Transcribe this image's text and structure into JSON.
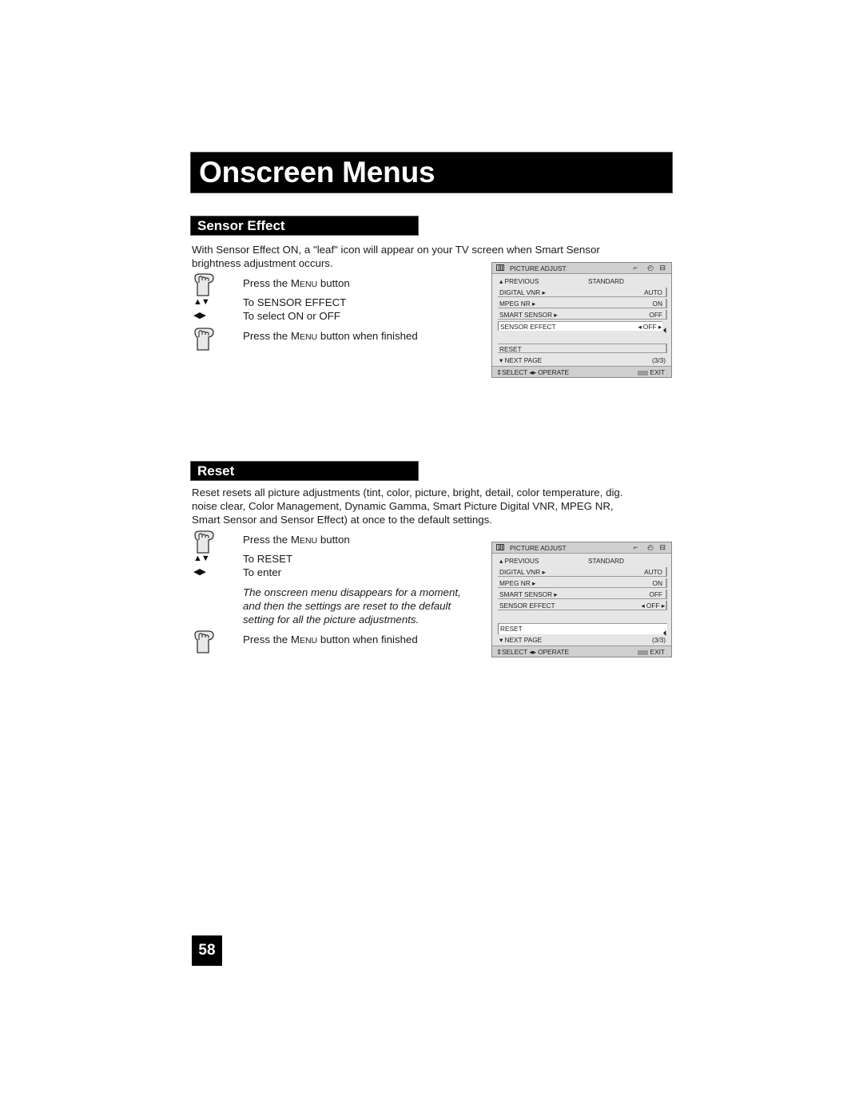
{
  "page_title": "Onscreen Menus",
  "page_number": "58",
  "sections": [
    {
      "heading": "Sensor Effect",
      "intro_line1": "With Sensor Effect ON, a \"leaf\" icon will appear on your TV screen when Smart Sensor",
      "intro_line2": "brightness adjustment occurs.",
      "steps": [
        {
          "icon": "hand-press-icon",
          "pre": "Press the M",
          "sc": "ENU",
          "post": " button"
        },
        {
          "icon": "up-down-arrows-icon",
          "text": "To SENSOR EFFECT"
        },
        {
          "icon": "left-right-arrows-icon",
          "text": "To select ON or OFF"
        },
        {
          "icon": "hand-press-icon",
          "pre": "Press the M",
          "sc": "ENU",
          "post": " button when finished"
        }
      ],
      "menu": {
        "title": "PICTURE ADJUST",
        "previous": "PREVIOUS",
        "mode": "STANDARD",
        "items": [
          {
            "label": "DIGITAL VNR",
            "value": "AUTO"
          },
          {
            "label": "MPEG NR",
            "value": "ON"
          },
          {
            "label": "SMART SENSOR",
            "value": "OFF"
          },
          {
            "label": "SENSOR EFFECT",
            "value": "OFF"
          }
        ],
        "reset": "RESET",
        "next_page": "NEXT PAGE",
        "page": "(3/3)",
        "footer_select": "SELECT",
        "footer_operate": "OPERATE",
        "footer_exit": "EXIT",
        "selected": "SENSOR EFFECT"
      }
    },
    {
      "heading": "Reset",
      "intro_line1": "Reset resets all picture adjustments (tint, color, picture, bright, detail, color temperature, dig.",
      "intro_line2": "noise clear, Color Management, Dynamic Gamma, Smart Picture Digital VNR, MPEG NR,",
      "intro_line3": "Smart Sensor and Sensor Effect) at once to the default settings.",
      "steps": [
        {
          "icon": "hand-press-icon",
          "pre": "Press the M",
          "sc": "ENU",
          "post": " button"
        },
        {
          "icon": "up-down-arrows-icon",
          "text": "To RESET"
        },
        {
          "icon": "left-right-arrows-icon",
          "text": "To enter"
        },
        {
          "icon": "hand-press-icon",
          "pre": "Press the M",
          "sc": "ENU",
          "post": " button when finished"
        }
      ],
      "note_line1": "The onscreen menu disappears for a moment,",
      "note_line2": "and then the settings are reset to the default",
      "note_line3": "setting for all the picture adjustments.",
      "menu": {
        "title": "PICTURE ADJUST",
        "previous": "PREVIOUS",
        "mode": "STANDARD",
        "items": [
          {
            "label": "DIGITAL VNR",
            "value": "AUTO"
          },
          {
            "label": "MPEG NR",
            "value": "ON"
          },
          {
            "label": "SMART SENSOR",
            "value": "OFF"
          },
          {
            "label": "SENSOR EFFECT",
            "value": "OFF"
          }
        ],
        "reset": "RESET",
        "next_page": "NEXT PAGE",
        "page": "(3/3)",
        "footer_select": "SELECT",
        "footer_operate": "OPERATE",
        "footer_exit": "EXIT",
        "selected": "RESET"
      }
    }
  ]
}
